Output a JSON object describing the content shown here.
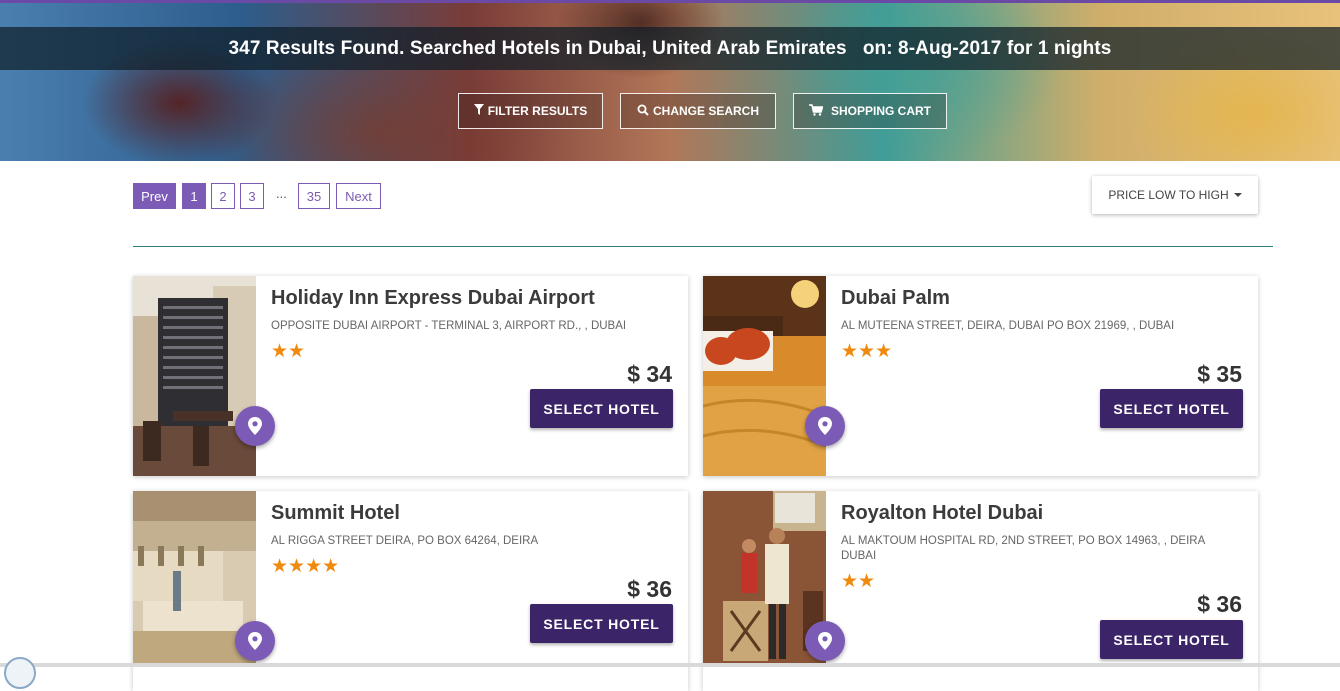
{
  "header": {
    "title": "347 Results Found. Searched Hotels in Dubai, United Arab Emirates   on: 8-Aug-2017 for 1 nights",
    "buttons": {
      "filter": "FILTER RESULTS",
      "change_search": "CHANGE SEARCH",
      "cart": "SHOPPING CART"
    }
  },
  "pagination": {
    "prev": "Prev",
    "pages": [
      "1",
      "2",
      "3"
    ],
    "ellipsis": "...",
    "last": "35",
    "next": "Next",
    "current": "1"
  },
  "sort": {
    "label": "PRICE LOW TO HIGH"
  },
  "hotels": [
    {
      "name": "Holiday Inn Express Dubai Airport",
      "address": "OPPOSITE DUBAI AIRPORT - TERMINAL 3, AIRPORT RD., , DUBAI",
      "stars": 2,
      "stars_text": "★★",
      "price": "$ 34",
      "button": "SELECT HOTEL"
    },
    {
      "name": "Dubai Palm",
      "address": "AL MUTEENA STREET, DEIRA, DUBAI PO BOX 21969, , DUBAI",
      "stars": 3,
      "stars_text": "★★★",
      "price": "$ 35",
      "button": "SELECT HOTEL"
    },
    {
      "name": "Summit Hotel",
      "address": "AL RIGGA STREET DEIRA, PO BOX 64264, DEIRA",
      "stars": 4,
      "stars_text": "★★★★",
      "price": "$ 36",
      "button": "SELECT HOTEL"
    },
    {
      "name": "Royalton Hotel Dubai",
      "address": "AL MAKTOUM HOSPITAL RD, 2ND STREET, PO BOX 14963, , DEIRA DUBAI",
      "stars": 2,
      "stars_text": "★★",
      "price": "$ 36",
      "button": "SELECT HOTEL"
    }
  ],
  "colors": {
    "accent": "#7b5bb5",
    "button_dark": "#3b2468",
    "star": "#f08a0f",
    "divider": "#2c7a82"
  }
}
